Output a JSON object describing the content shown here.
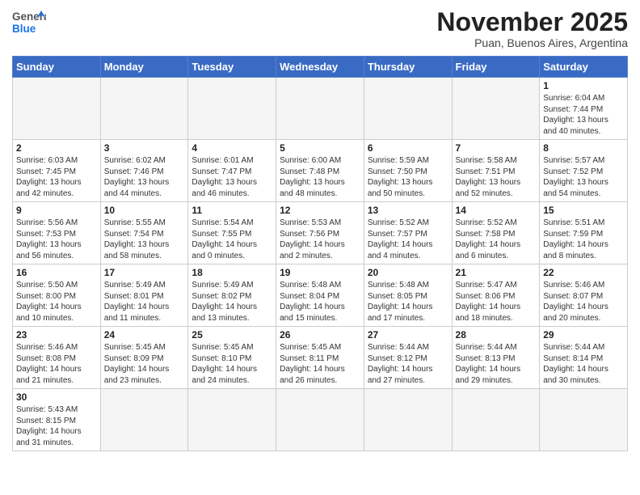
{
  "header": {
    "logo_general": "General",
    "logo_blue": "Blue",
    "month_title": "November 2025",
    "subtitle": "Puan, Buenos Aires, Argentina"
  },
  "days_of_week": [
    "Sunday",
    "Monday",
    "Tuesday",
    "Wednesday",
    "Thursday",
    "Friday",
    "Saturday"
  ],
  "weeks": [
    [
      {
        "num": "",
        "info": ""
      },
      {
        "num": "",
        "info": ""
      },
      {
        "num": "",
        "info": ""
      },
      {
        "num": "",
        "info": ""
      },
      {
        "num": "",
        "info": ""
      },
      {
        "num": "",
        "info": ""
      },
      {
        "num": "1",
        "info": "Sunrise: 6:04 AM\nSunset: 7:44 PM\nDaylight: 13 hours and 40 minutes."
      }
    ],
    [
      {
        "num": "2",
        "info": "Sunrise: 6:03 AM\nSunset: 7:45 PM\nDaylight: 13 hours and 42 minutes."
      },
      {
        "num": "3",
        "info": "Sunrise: 6:02 AM\nSunset: 7:46 PM\nDaylight: 13 hours and 44 minutes."
      },
      {
        "num": "4",
        "info": "Sunrise: 6:01 AM\nSunset: 7:47 PM\nDaylight: 13 hours and 46 minutes."
      },
      {
        "num": "5",
        "info": "Sunrise: 6:00 AM\nSunset: 7:48 PM\nDaylight: 13 hours and 48 minutes."
      },
      {
        "num": "6",
        "info": "Sunrise: 5:59 AM\nSunset: 7:50 PM\nDaylight: 13 hours and 50 minutes."
      },
      {
        "num": "7",
        "info": "Sunrise: 5:58 AM\nSunset: 7:51 PM\nDaylight: 13 hours and 52 minutes."
      },
      {
        "num": "8",
        "info": "Sunrise: 5:57 AM\nSunset: 7:52 PM\nDaylight: 13 hours and 54 minutes."
      }
    ],
    [
      {
        "num": "9",
        "info": "Sunrise: 5:56 AM\nSunset: 7:53 PM\nDaylight: 13 hours and 56 minutes."
      },
      {
        "num": "10",
        "info": "Sunrise: 5:55 AM\nSunset: 7:54 PM\nDaylight: 13 hours and 58 minutes."
      },
      {
        "num": "11",
        "info": "Sunrise: 5:54 AM\nSunset: 7:55 PM\nDaylight: 14 hours and 0 minutes."
      },
      {
        "num": "12",
        "info": "Sunrise: 5:53 AM\nSunset: 7:56 PM\nDaylight: 14 hours and 2 minutes."
      },
      {
        "num": "13",
        "info": "Sunrise: 5:52 AM\nSunset: 7:57 PM\nDaylight: 14 hours and 4 minutes."
      },
      {
        "num": "14",
        "info": "Sunrise: 5:52 AM\nSunset: 7:58 PM\nDaylight: 14 hours and 6 minutes."
      },
      {
        "num": "15",
        "info": "Sunrise: 5:51 AM\nSunset: 7:59 PM\nDaylight: 14 hours and 8 minutes."
      }
    ],
    [
      {
        "num": "16",
        "info": "Sunrise: 5:50 AM\nSunset: 8:00 PM\nDaylight: 14 hours and 10 minutes."
      },
      {
        "num": "17",
        "info": "Sunrise: 5:49 AM\nSunset: 8:01 PM\nDaylight: 14 hours and 11 minutes."
      },
      {
        "num": "18",
        "info": "Sunrise: 5:49 AM\nSunset: 8:02 PM\nDaylight: 14 hours and 13 minutes."
      },
      {
        "num": "19",
        "info": "Sunrise: 5:48 AM\nSunset: 8:04 PM\nDaylight: 14 hours and 15 minutes."
      },
      {
        "num": "20",
        "info": "Sunrise: 5:48 AM\nSunset: 8:05 PM\nDaylight: 14 hours and 17 minutes."
      },
      {
        "num": "21",
        "info": "Sunrise: 5:47 AM\nSunset: 8:06 PM\nDaylight: 14 hours and 18 minutes."
      },
      {
        "num": "22",
        "info": "Sunrise: 5:46 AM\nSunset: 8:07 PM\nDaylight: 14 hours and 20 minutes."
      }
    ],
    [
      {
        "num": "23",
        "info": "Sunrise: 5:46 AM\nSunset: 8:08 PM\nDaylight: 14 hours and 21 minutes."
      },
      {
        "num": "24",
        "info": "Sunrise: 5:45 AM\nSunset: 8:09 PM\nDaylight: 14 hours and 23 minutes."
      },
      {
        "num": "25",
        "info": "Sunrise: 5:45 AM\nSunset: 8:10 PM\nDaylight: 14 hours and 24 minutes."
      },
      {
        "num": "26",
        "info": "Sunrise: 5:45 AM\nSunset: 8:11 PM\nDaylight: 14 hours and 26 minutes."
      },
      {
        "num": "27",
        "info": "Sunrise: 5:44 AM\nSunset: 8:12 PM\nDaylight: 14 hours and 27 minutes."
      },
      {
        "num": "28",
        "info": "Sunrise: 5:44 AM\nSunset: 8:13 PM\nDaylight: 14 hours and 29 minutes."
      },
      {
        "num": "29",
        "info": "Sunrise: 5:44 AM\nSunset: 8:14 PM\nDaylight: 14 hours and 30 minutes."
      }
    ],
    [
      {
        "num": "30",
        "info": "Sunrise: 5:43 AM\nSunset: 8:15 PM\nDaylight: 14 hours and 31 minutes."
      },
      {
        "num": "",
        "info": ""
      },
      {
        "num": "",
        "info": ""
      },
      {
        "num": "",
        "info": ""
      },
      {
        "num": "",
        "info": ""
      },
      {
        "num": "",
        "info": ""
      },
      {
        "num": "",
        "info": ""
      }
    ]
  ]
}
